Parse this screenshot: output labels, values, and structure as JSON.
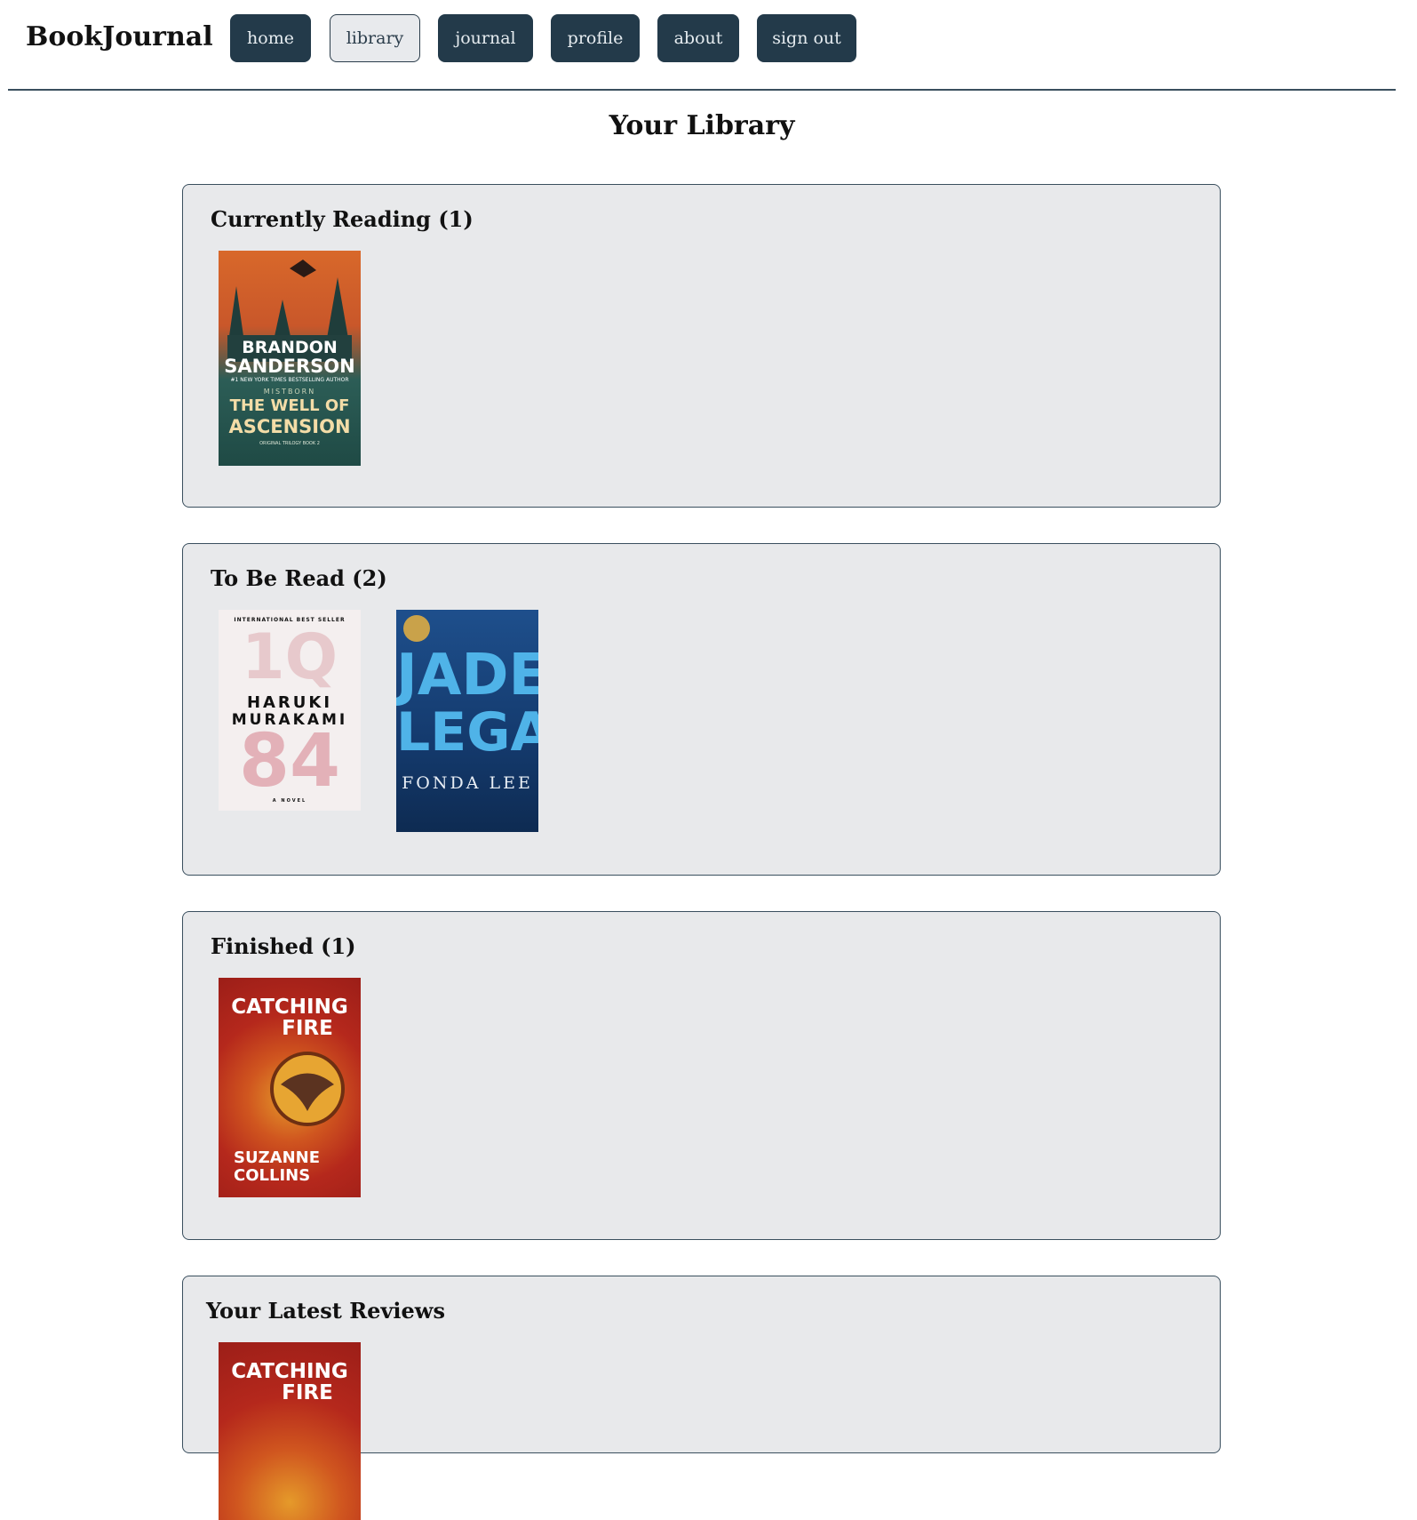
{
  "app": {
    "brand": "BookJournal"
  },
  "nav": {
    "items": [
      {
        "label": "home",
        "active": false
      },
      {
        "label": "library",
        "active": true
      },
      {
        "label": "journal",
        "active": false
      },
      {
        "label": "profile",
        "active": false
      },
      {
        "label": "about",
        "active": false
      },
      {
        "label": "sign out",
        "active": false
      }
    ]
  },
  "page": {
    "title": "Your Library"
  },
  "sections": {
    "currently_reading": {
      "title": "Currently Reading (1)",
      "books": [
        {
          "author": "BRANDON SANDERSON",
          "author_line1": "BRANDON",
          "author_line2": "SANDERSON",
          "tagline": "#1 NEW YORK TIMES BESTSELLING AUTHOR",
          "series": "MISTBORN",
          "title_line1": "THE WELL OF",
          "title_line2": "ASCENSION",
          "footer": "ORIGINAL TRILOGY BOOK 2"
        }
      ]
    },
    "to_be_read": {
      "title": "To Be Read (2)",
      "books": [
        {
          "top": "INTERNATIONAL BEST SELLER",
          "title_top": "1Q",
          "author_line1": "HARUKI",
          "author_line2": "MURAKAMI",
          "title_bottom": "84",
          "footer": "A NOVEL"
        },
        {
          "title_line1": "JADE",
          "title_line2": "LEGACY",
          "author": "FONDA LEE"
        }
      ]
    },
    "finished": {
      "title": "Finished (1)",
      "books": [
        {
          "title_line1": "CATCHING",
          "title_line2": "FIRE",
          "author_line1": "SUZANNE",
          "author_line2": "COLLINS"
        }
      ]
    },
    "latest_reviews": {
      "title": "Your Latest Reviews",
      "books": [
        {
          "title_line1": "CATCHING",
          "title_line2": "FIRE"
        }
      ]
    }
  },
  "colors": {
    "nav_button": "#233a4a",
    "nav_button_active": "#e8eaed",
    "section_bg": "#e8e9eb",
    "border": "#3a4f5e"
  }
}
